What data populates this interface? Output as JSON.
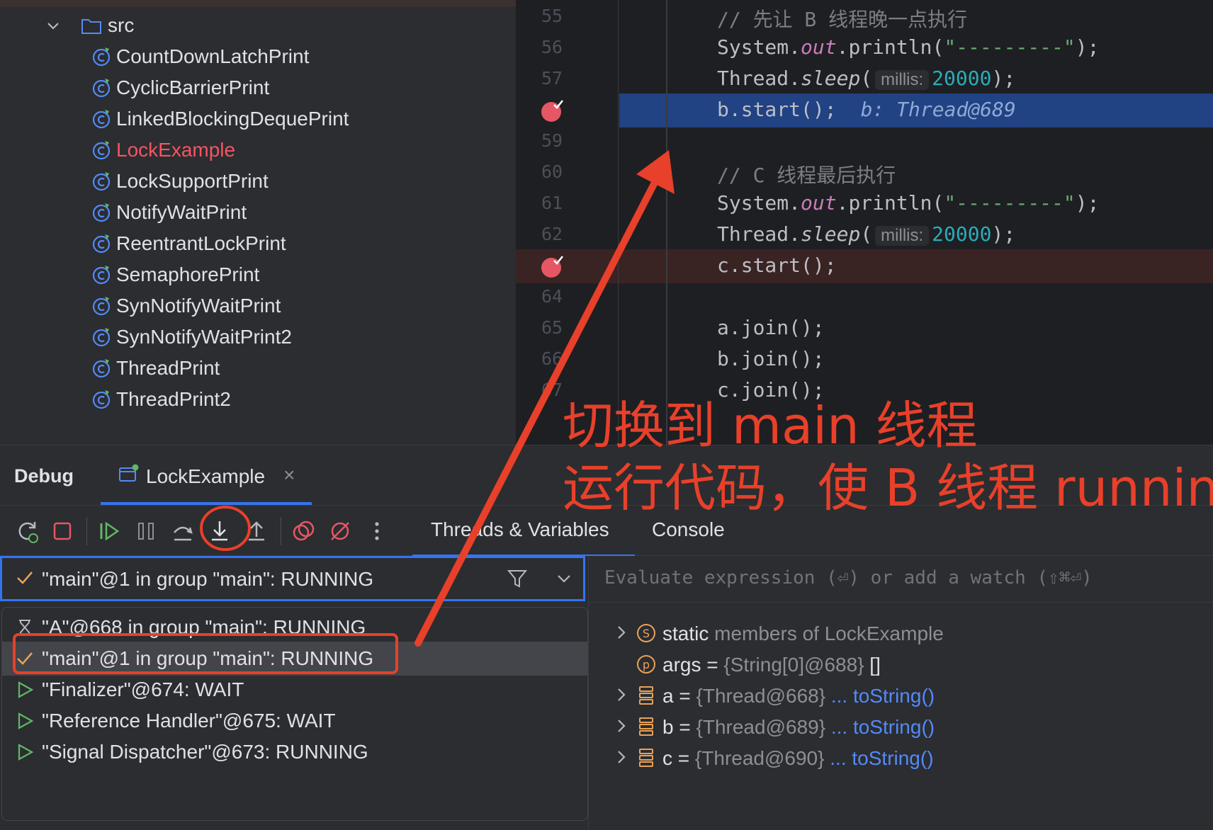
{
  "project_tree": {
    "folder": "src",
    "items": [
      {
        "label": "CountDownLatchPrint",
        "error": false
      },
      {
        "label": "CyclicBarrierPrint",
        "error": false
      },
      {
        "label": "LinkedBlockingDequePrint",
        "error": false
      },
      {
        "label": "LockExample",
        "error": true
      },
      {
        "label": "LockSupportPrint",
        "error": false
      },
      {
        "label": "NotifyWaitPrint",
        "error": false
      },
      {
        "label": "ReentrantLockPrint",
        "error": false
      },
      {
        "label": "SemaphorePrint",
        "error": false
      },
      {
        "label": "SynNotifyWaitPrint",
        "error": false
      },
      {
        "label": "SynNotifyWaitPrint2",
        "error": false
      },
      {
        "label": "ThreadPrint",
        "error": false
      },
      {
        "label": "ThreadPrint2",
        "error": false
      }
    ]
  },
  "editor": {
    "lines": [
      {
        "num": "55",
        "comment": "// 先让 B 线程晚一点执行"
      },
      {
        "num": "56",
        "sys": "System.",
        "out": "out",
        "rest": ".println(",
        "str": "\"---------\"",
        "end": ");"
      },
      {
        "num": "57",
        "pre": "Thread.",
        "sleep": "sleep",
        "open": "(",
        "hint": "millis:",
        "numval": "20000",
        "end": ");"
      },
      {
        "num": "",
        "code": "b.start();",
        "inline": "b: Thread@689"
      },
      {
        "num": "59"
      },
      {
        "num": "60",
        "comment": "// C 线程最后执行"
      },
      {
        "num": "61",
        "sys": "System.",
        "out": "out",
        "rest": ".println(",
        "str": "\"---------\"",
        "end": ");"
      },
      {
        "num": "62",
        "pre": "Thread.",
        "sleep": "sleep",
        "open": "(",
        "hint": "millis:",
        "numval": "20000",
        "end": ");"
      },
      {
        "num": "",
        "code": "c.start();"
      },
      {
        "num": "64"
      },
      {
        "num": "65",
        "code": "a.join();"
      },
      {
        "num": "66",
        "code": "b.join();"
      },
      {
        "num": "67",
        "code": "c.join();"
      }
    ]
  },
  "debug": {
    "title": "Debug",
    "session_tab": "LockExample",
    "close": "×",
    "tabs": {
      "threads": "Threads & Variables",
      "console": "Console"
    },
    "selected_thread": "\"main\"@1 in group \"main\": RUNNING",
    "threads": [
      {
        "label": "\"A\"@668 in group \"main\": RUNNING",
        "icon": "hourglass-icon"
      },
      {
        "label": "\"main\"@1 in group \"main\": RUNNING",
        "icon": "check-icon"
      },
      {
        "label": "\"Finalizer\"@674: WAIT",
        "icon": "play-outline-icon"
      },
      {
        "label": "\"Reference Handler\"@675: WAIT",
        "icon": "play-outline-icon"
      },
      {
        "label": "\"Signal Dispatcher\"@673: RUNNING",
        "icon": "play-outline-icon"
      }
    ],
    "eval_placeholder": "Evaluate expression (⏎) or add a watch (⇧⌘⏎)",
    "variables": [
      {
        "name": "static",
        "value": " members of LockExample",
        "link": "",
        "icon": "static-icon",
        "expandable": true
      },
      {
        "name": "args",
        "eq": " = ",
        "value": "{String[0]@688}",
        "tail": " []",
        "link": "",
        "icon": "param-icon",
        "expandable": false
      },
      {
        "name": "a",
        "eq": " = ",
        "value": "{Thread@668}",
        "link": " ... toString()",
        "icon": "field-icon",
        "expandable": true
      },
      {
        "name": "b",
        "eq": " = ",
        "value": "{Thread@689}",
        "link": " ... toString()",
        "icon": "field-icon",
        "expandable": true
      },
      {
        "name": "c",
        "eq": " = ",
        "value": "{Thread@690}",
        "link": " ... toString()",
        "icon": "field-icon",
        "expandable": true
      }
    ]
  },
  "annotation": {
    "line1": "切换到 main 线程",
    "line2": "运行代码，使 B 线程 running",
    "color": "#e8402a"
  },
  "colors": {
    "accent": "#3574f0",
    "exec_line": "#214283",
    "breakpoint": "#e55765"
  }
}
